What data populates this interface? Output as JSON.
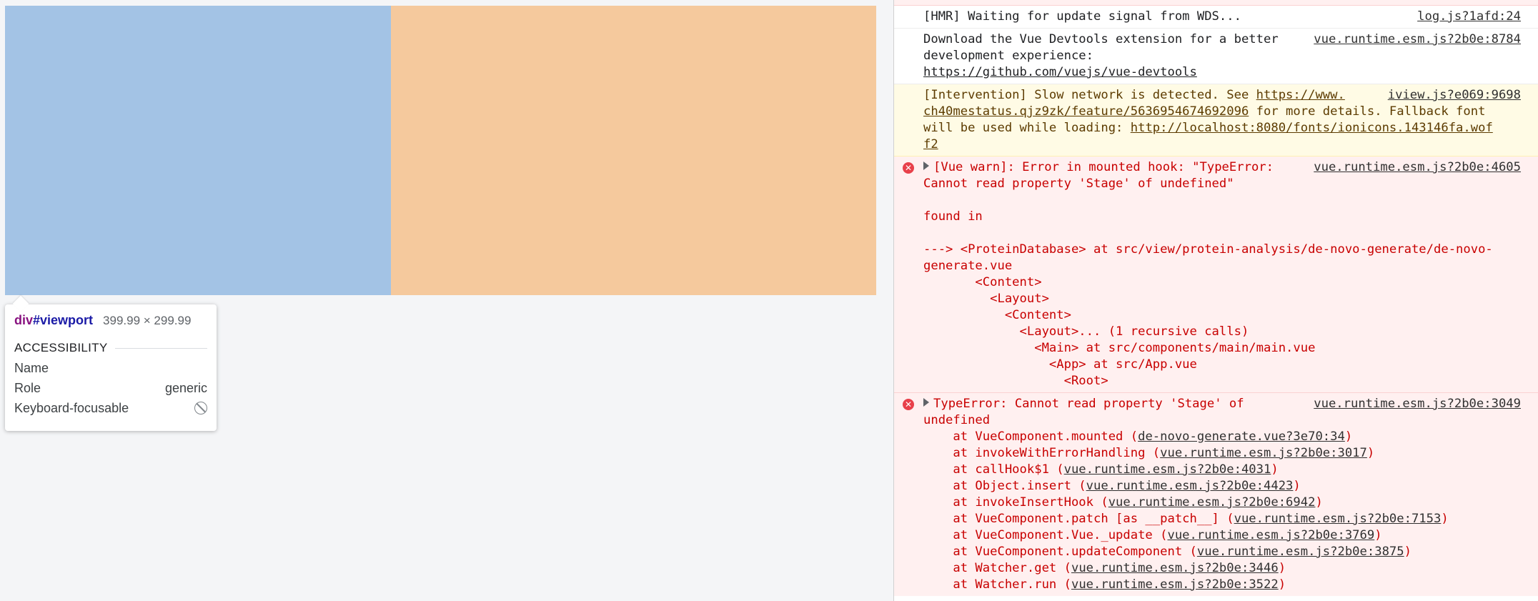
{
  "viewport": {
    "left_color": "#a3c3e5",
    "right_color": "#f5c99d"
  },
  "tooltip": {
    "tag": "div",
    "id": "#viewport",
    "size": "399.99 × 299.99",
    "section": "ACCESSIBILITY",
    "rows": [
      {
        "label": "Name",
        "value": ""
      },
      {
        "label": "Role",
        "value": "generic"
      },
      {
        "label": "Keyboard-focusable",
        "value": ""
      }
    ],
    "not_allowed_icon": "not-allowed-icon"
  },
  "console": {
    "msg1": {
      "text": "[HMR] Waiting for update signal from WDS...",
      "source": "log.js?1afd:24"
    },
    "msg2": {
      "text": "Download the Vue Devtools extension for a better development experience:",
      "link": "https://github.com/vuejs/vue-devtools",
      "source": "vue.runtime.esm.js?2b0e:8784"
    },
    "msg3": {
      "prefix": "[Intervention] Slow network is detected. See ",
      "link1": "https://www.chromestatus.com/feature/5636954674692096",
      "link1_a": "https://www.",
      "link1_b": "ch40mestatus.qjz9zk/feature/5636954674692096",
      "middle": " for more details. Fallback font will be used while loading: ",
      "link2_a": "http://localhost:8080/fonts/ionicons.143146fa.wof",
      "link2_b": "f2",
      "source": "iview.js?e069:9698"
    },
    "msg4": {
      "line1": "[Vue warn]: Error in mounted hook: \"TypeError:",
      "line2": "Cannot read property 'Stage' of undefined\"",
      "found": "found in",
      "trace1": "---> <ProteinDatabase> at src/view/protein-analysis/de-novo-generate/de-novo-",
      "trace1b": "generate.vue",
      "trace2": "       <Content>",
      "trace3": "         <Layout>",
      "trace4": "           <Content>",
      "trace5": "             <Layout>... (1 recursive calls)",
      "trace6": "               <Main> at src/components/main/main.vue",
      "trace7": "                 <App> at src/App.vue",
      "trace8": "                   <Root>",
      "source": "vue.runtime.esm.js?2b0e:4605"
    },
    "msg5": {
      "line1": "TypeError: Cannot read property 'Stage' of",
      "line2": "undefined",
      "source": "vue.runtime.esm.js?2b0e:3049",
      "stack": [
        {
          "fn": "    at VueComponent.mounted (",
          "loc": "de-novo-generate.vue?3e70:34"
        },
        {
          "fn": "    at invokeWithErrorHandling (",
          "loc": "vue.runtime.esm.js?2b0e:3017"
        },
        {
          "fn": "    at callHook$1 (",
          "loc": "vue.runtime.esm.js?2b0e:4031"
        },
        {
          "fn": "    at Object.insert (",
          "loc": "vue.runtime.esm.js?2b0e:4423"
        },
        {
          "fn": "    at invokeInsertHook (",
          "loc": "vue.runtime.esm.js?2b0e:6942"
        },
        {
          "fn": "    at VueComponent.patch [as __patch__] (",
          "loc": "vue.runtime.esm.js?2b0e:7153"
        },
        {
          "fn": "    at VueComponent.Vue._update (",
          "loc": "vue.runtime.esm.js?2b0e:3769"
        },
        {
          "fn": "    at VueComponent.updateComponent (",
          "loc": "vue.runtime.esm.js?2b0e:3875"
        },
        {
          "fn": "    at Watcher.get (",
          "loc": "vue.runtime.esm.js?2b0e:3446"
        },
        {
          "fn": "    at Watcher.run (",
          "loc": "vue.runtime.esm.js?2b0e:3522"
        }
      ]
    }
  }
}
